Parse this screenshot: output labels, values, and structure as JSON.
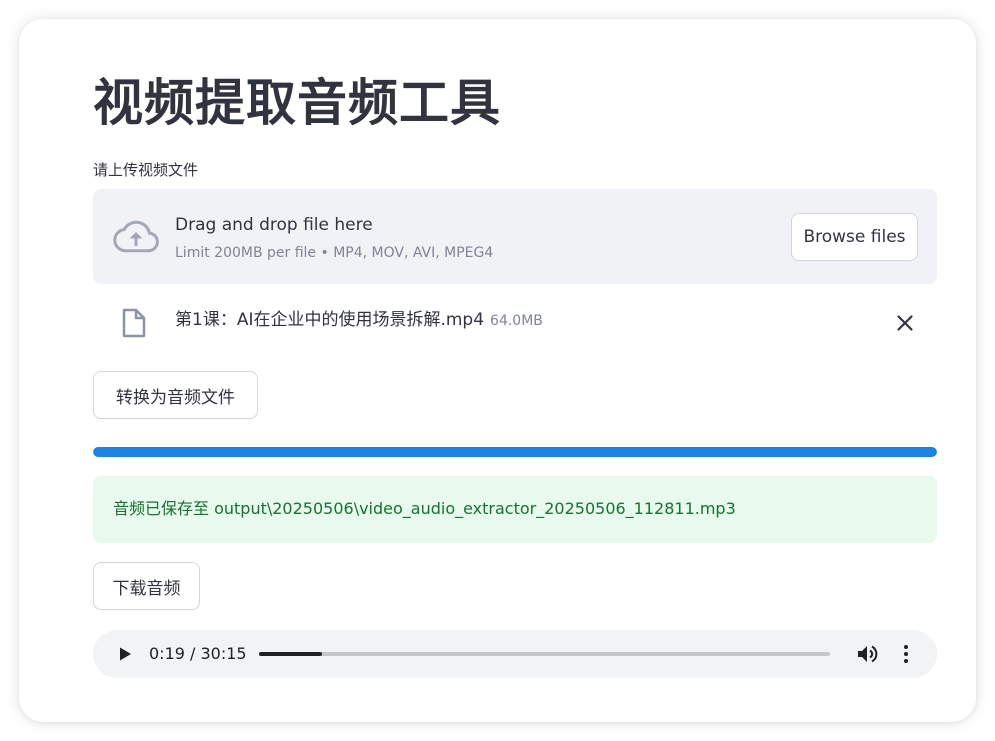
{
  "page": {
    "title": "视频提取音频工具"
  },
  "uploader": {
    "label": "请上传视频文件",
    "drop_text": "Drag and drop file here",
    "limit_text": "Limit 200MB per file • MP4, MOV, AVI, MPEG4",
    "browse_label": "Browse files",
    "icon": "cloud-upload-icon"
  },
  "uploaded_file": {
    "name": "第1课：AI在企业中的使用场景拆解.mp4",
    "size": "64.0MB",
    "icon": "file-icon",
    "remove_icon": "close-icon"
  },
  "convert_button": {
    "label": "转换为音频文件"
  },
  "progress": {
    "value": 1.0,
    "color": "#1c83e1"
  },
  "success": {
    "message": "音频已保存至 output\\20250506\\video_audio_extractor_20250506_112811.mp3",
    "bg_color": "#e8f9ee",
    "text_color": "#177233"
  },
  "download_button": {
    "label": "下载音频"
  },
  "audio_player": {
    "time": "0:19 / 30:15",
    "current_seconds": 19,
    "duration_seconds": 1815,
    "icons": [
      "play-icon",
      "volume-icon",
      "more-vertical-icon"
    ]
  }
}
